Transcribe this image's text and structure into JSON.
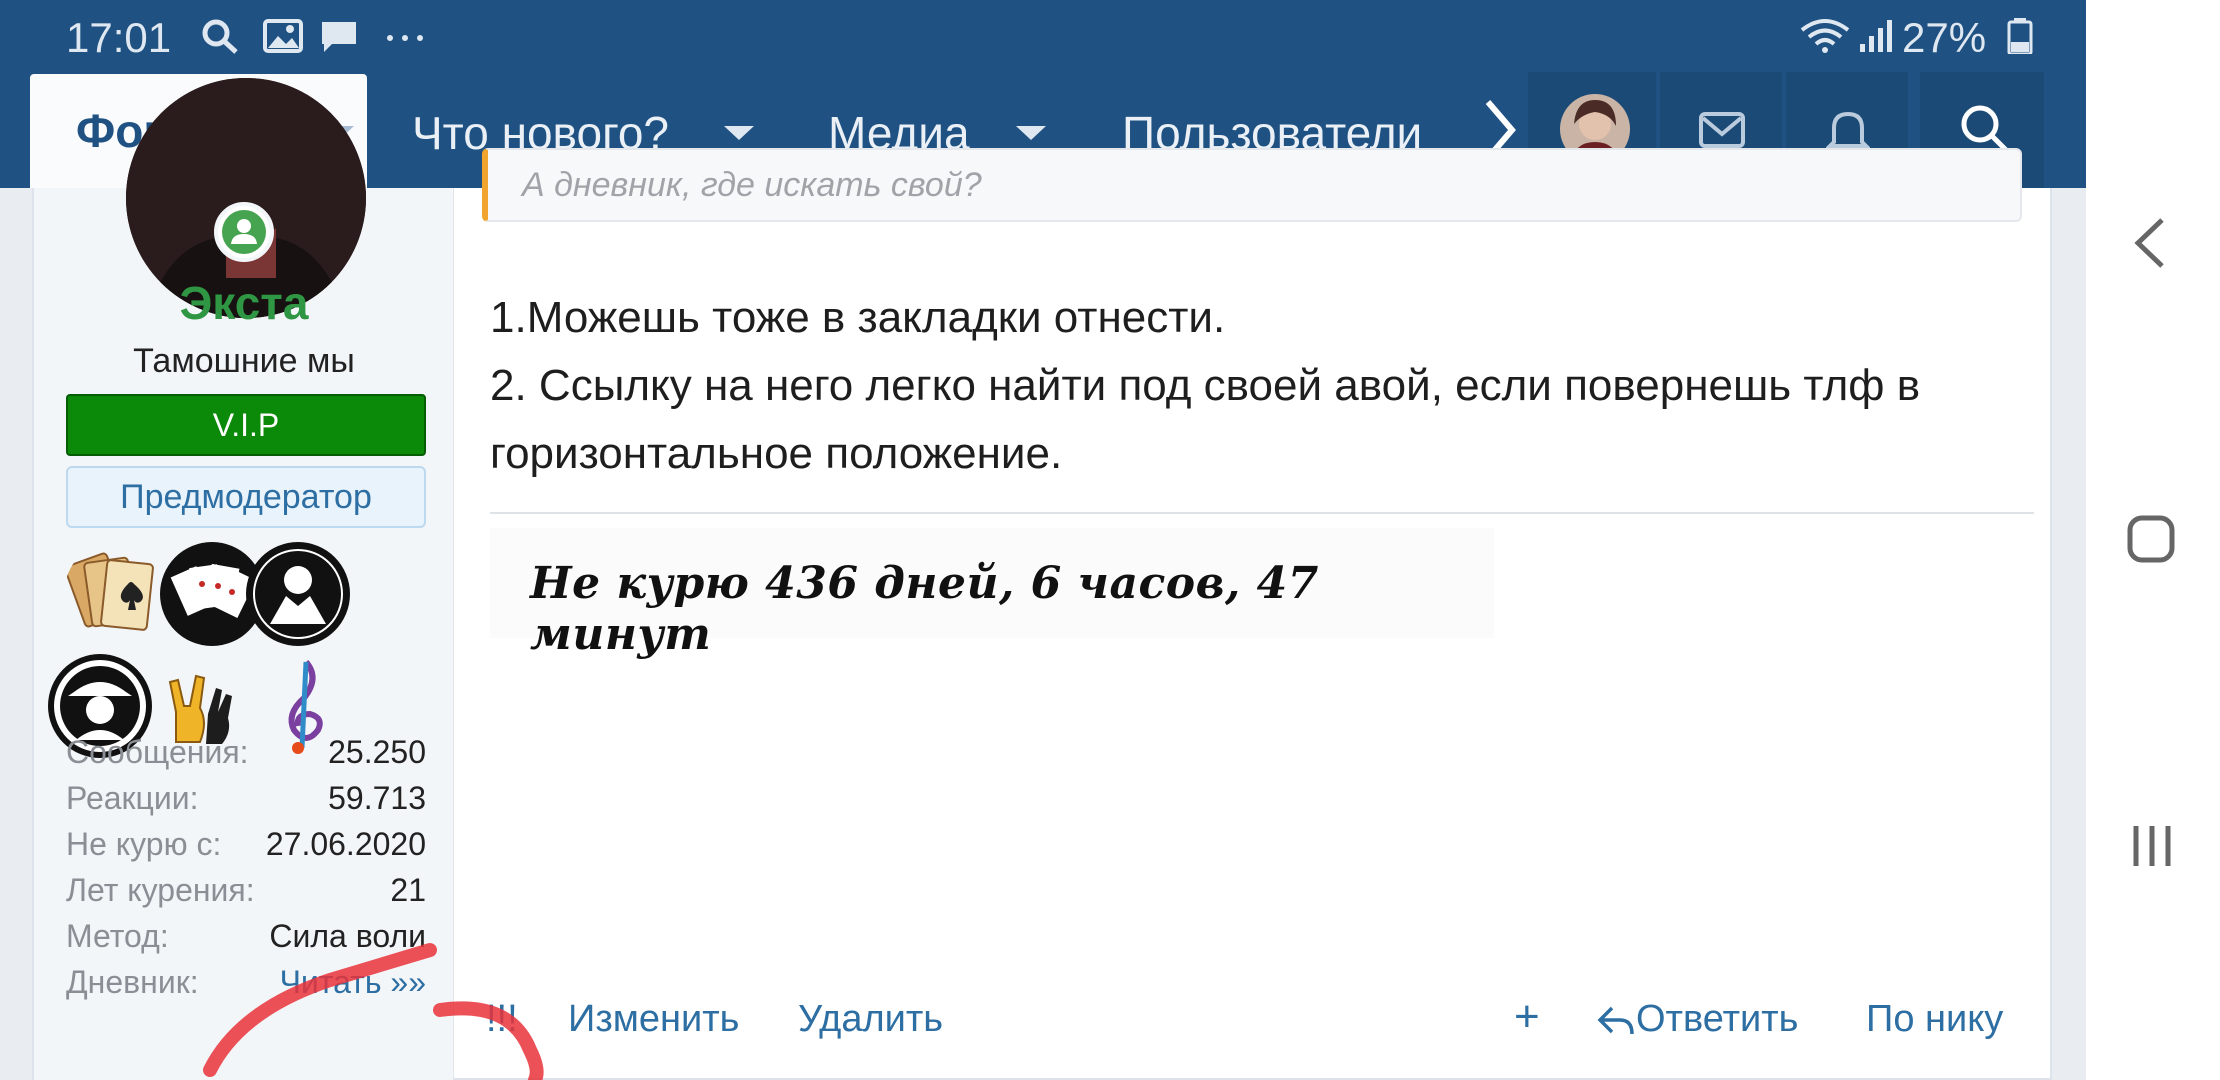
{
  "status_bar": {
    "time": "17:01",
    "icons": [
      "search-icon",
      "image-icon",
      "chat-icon",
      "more-dots-icon"
    ],
    "right_icons": [
      "wifi-icon",
      "signal-icon"
    ],
    "battery": "27%"
  },
  "nav": {
    "forums": "Форумы",
    "whats_new": "Что нового?",
    "media": "Медиа",
    "members": "Пользователи",
    "icons": [
      "chevron-right-icon",
      "avatar",
      "mail-icon",
      "bell-icon",
      "search-icon"
    ]
  },
  "user": {
    "name": "Экста",
    "title": "Тамошние мы",
    "banner_vip": "V.I.P",
    "banner_role": "Предмодератор",
    "trophies": [
      "cards-icon",
      "poker-hand-icon",
      "hands-icon",
      "spy-icon",
      "rock-hand-icon",
      "treble-clef-icon"
    ],
    "stats": [
      {
        "k": "Сообщения:",
        "v": "25.250"
      },
      {
        "k": "Реакции:",
        "v": "59.713"
      },
      {
        "k": "Не курю с:",
        "v": "27.06.2020"
      },
      {
        "k": "Лет курения:",
        "v": "21"
      },
      {
        "k": "Метод:",
        "v": "Сила воли"
      },
      {
        "k": "Дневник:",
        "v": "Читать »»"
      }
    ]
  },
  "post": {
    "quote": "А дневник, где искать свой?",
    "line1": "1.Можешь тоже в закладки отнести.",
    "line2": "2. Ссылку на него легко найти под своей авой, если повернешь тлф в горизонтальное положение.",
    "signature": "Не курю  436 дней, 6 часов, 47 минут",
    "actions": {
      "report": "!!!",
      "edit": "Изменить",
      "delete": "Удалить",
      "add": "+",
      "reply": "Ответить",
      "by_nick": "По нику"
    }
  },
  "colors": {
    "header": "#1f5282",
    "username": "#2f9644",
    "vip": "#0b8a09",
    "link": "#2d6ea3",
    "annotation": "#e8323a"
  }
}
